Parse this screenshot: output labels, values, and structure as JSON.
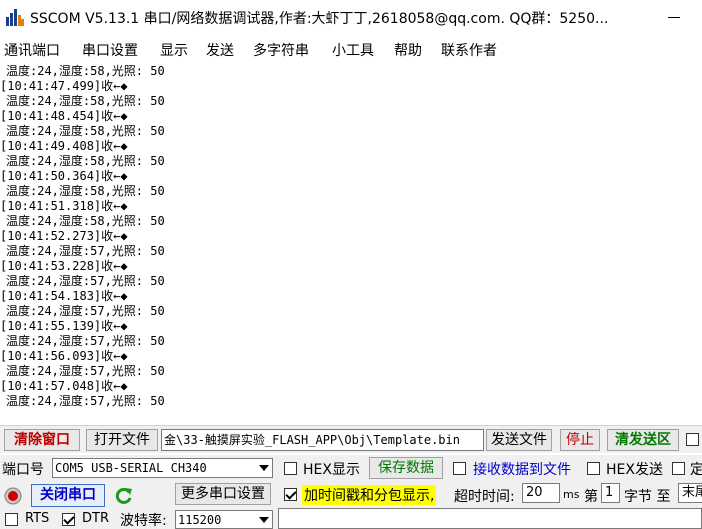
{
  "window": {
    "title": "SSCOM V5.13.1 串口/网络数据调试器,作者:大虾丁丁,2618058@qq.com. QQ群：5250..."
  },
  "menu": [
    "通讯端口",
    "串口设置",
    "显示",
    "发送",
    "多字符串",
    "小工具",
    "帮助",
    "联系作者"
  ],
  "receive_lines": [
    {
      "type": "data",
      "text": "温度:24,湿度:58,光照: 50"
    },
    {
      "type": "ts",
      "text": "[10:41:47.499]收←◆"
    },
    {
      "type": "data",
      "text": "温度:24,湿度:58,光照: 50"
    },
    {
      "type": "ts",
      "text": "[10:41:48.454]收←◆"
    },
    {
      "type": "data",
      "text": "温度:24,湿度:58,光照: 50"
    },
    {
      "type": "ts",
      "text": "[10:41:49.408]收←◆"
    },
    {
      "type": "data",
      "text": "温度:24,湿度:58,光照: 50"
    },
    {
      "type": "ts",
      "text": "[10:41:50.364]收←◆"
    },
    {
      "type": "data",
      "text": "温度:24,湿度:58,光照: 50"
    },
    {
      "type": "ts",
      "text": "[10:41:51.318]收←◆"
    },
    {
      "type": "data",
      "text": "温度:24,湿度:58,光照: 50"
    },
    {
      "type": "ts",
      "text": "[10:41:52.273]收←◆"
    },
    {
      "type": "data",
      "text": "温度:24,湿度:57,光照: 50"
    },
    {
      "type": "ts",
      "text": "[10:41:53.228]收←◆"
    },
    {
      "type": "data",
      "text": "温度:24,湿度:57,光照: 50"
    },
    {
      "type": "ts",
      "text": "[10:41:54.183]收←◆"
    },
    {
      "type": "data",
      "text": "温度:24,湿度:57,光照: 50"
    },
    {
      "type": "ts",
      "text": "[10:41:55.139]收←◆"
    },
    {
      "type": "data",
      "text": "温度:24,湿度:57,光照: 50"
    },
    {
      "type": "ts",
      "text": "[10:41:56.093]收←◆"
    },
    {
      "type": "data",
      "text": "温度:24,湿度:57,光照: 50"
    },
    {
      "type": "ts",
      "text": "[10:41:57.048]收←◆"
    },
    {
      "type": "data",
      "text": "温度:24,湿度:57,光照: 50"
    }
  ],
  "toolbar": {
    "clear_window": "清除窗口",
    "open_file": "打开文件",
    "file_path": "金\\33-触摸屏实验_FLASH_APP\\Obj\\Template.bin",
    "send_file": "发送文件",
    "stop": "停止",
    "clear_send": "清发送区"
  },
  "port": {
    "label": "端口号",
    "value": "COM5 USB-SERIAL CH340",
    "hex_display": "HEX显示",
    "save_data": "保存数据",
    "recv_to_file": "接收数据到文件",
    "hex_send": "HEX发送",
    "timed_send": "定"
  },
  "row3": {
    "close_port": "关闭串口",
    "more_settings": "更多串口设置",
    "timestamp": "加时间戳和分包显示,",
    "timeout_label": "超时时间:",
    "timeout_value": "20",
    "timeout_unit": "ms",
    "nth_label": "第",
    "nth_value": "1",
    "byte_label": "字节 至",
    "end_label": "末尾"
  },
  "row4": {
    "rts": "RTS",
    "dtr": "DTR",
    "baud_label": "波特率:",
    "baud_value": "115200"
  },
  "colors": {
    "clear_btn_text": "#c00000",
    "green_text": "#007a00",
    "blue_text": "#0000cc",
    "timestamp_bg": "#ffff00",
    "port_led": "#d00000"
  }
}
